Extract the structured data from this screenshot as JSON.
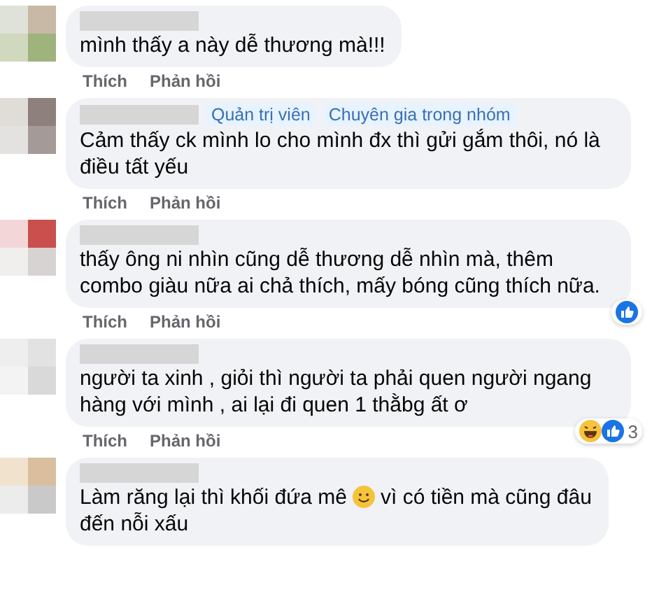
{
  "comments": [
    {
      "lines": [
        [
          {
            "kind": "text",
            "text": "mình thấy a này dễ thương mà!!!"
          }
        ]
      ],
      "actions": [
        "Thích",
        "Phản hồi"
      ]
    },
    {
      "badges": [
        "Quản trị viên",
        "Chuyên gia trong nhóm"
      ],
      "lines": [
        [
          {
            "kind": "text",
            "text": "Cảm thấy ck mình lo cho mình đx thì gửi gắm thôi, nó là điều tất yếu"
          }
        ]
      ],
      "actions": [
        "Thích",
        "Phản hồi"
      ]
    },
    {
      "lines": [
        [
          {
            "kind": "text",
            "text": "thấy ông ni nhìn cũng dễ thương dễ nhìn mà, thêm combo giàu nữa ai chả thích, mấy bóng cũng thích nữa."
          }
        ]
      ],
      "actions": [
        "Thích",
        "Phản hồi"
      ],
      "reactions": [
        {
          "kind": "like"
        }
      ]
    },
    {
      "lines": [
        [
          {
            "kind": "text",
            "text": "người ta xinh , giỏi thì người ta phải quen người ngang hàng với mình , ai lại đi quen 1 thằbg ất ơ"
          }
        ]
      ],
      "actions": [
        "Thích",
        "Phản hồi"
      ],
      "reactions": [
        {
          "kind": "haha"
        },
        {
          "kind": "like"
        }
      ],
      "reaction_count": "3"
    },
    {
      "lines": [
        [
          {
            "kind": "text",
            "text": "Làm răng lại thì khối đứa mê"
          },
          {
            "kind": "emoji"
          },
          {
            "kind": "text",
            "text": "vì có tiền mà cũng đâu"
          }
        ],
        [
          {
            "kind": "text",
            "text": "đến nỗi xấu"
          }
        ]
      ]
    }
  ]
}
